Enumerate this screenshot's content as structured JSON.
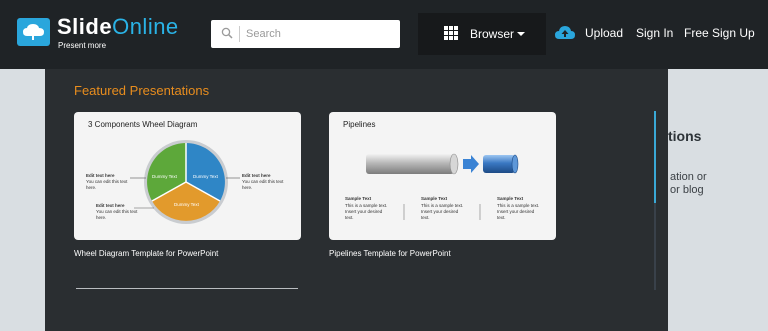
{
  "brand": {
    "name_part1": "Slide",
    "name_part2": "Online",
    "tagline": "Present more"
  },
  "search": {
    "placeholder": "Search"
  },
  "nav": {
    "browser_label": "Browser",
    "upload": "Upload",
    "sign_in": "Sign In",
    "free_sign_up": "Free Sign Up"
  },
  "featured": {
    "heading": "Featured Presentations",
    "items": [
      {
        "title": "Wheel Diagram Template for PowerPoint",
        "thumb_title": "3 Components Wheel Diagram",
        "labels": [
          "Dummy Text",
          "Dummy Text",
          "Dummy Text"
        ],
        "callout_head": "Edit text here",
        "callout_body": "You can edit this text here."
      },
      {
        "title": "Pipelines Template for PowerPoint",
        "thumb_title": "Pipelines",
        "sample_head": "Sample Text",
        "sample_body": "This is a sample text. Insert your desired text."
      }
    ]
  },
  "background_page": {
    "title_fragment": "tions",
    "line1": "ation or",
    "line2": "or blog"
  },
  "colors": {
    "accent_orange": "#e88d1e",
    "brand_blue": "#2aa6dc",
    "header_bg": "#1f2326",
    "panel_bg": "#2a2e31"
  }
}
